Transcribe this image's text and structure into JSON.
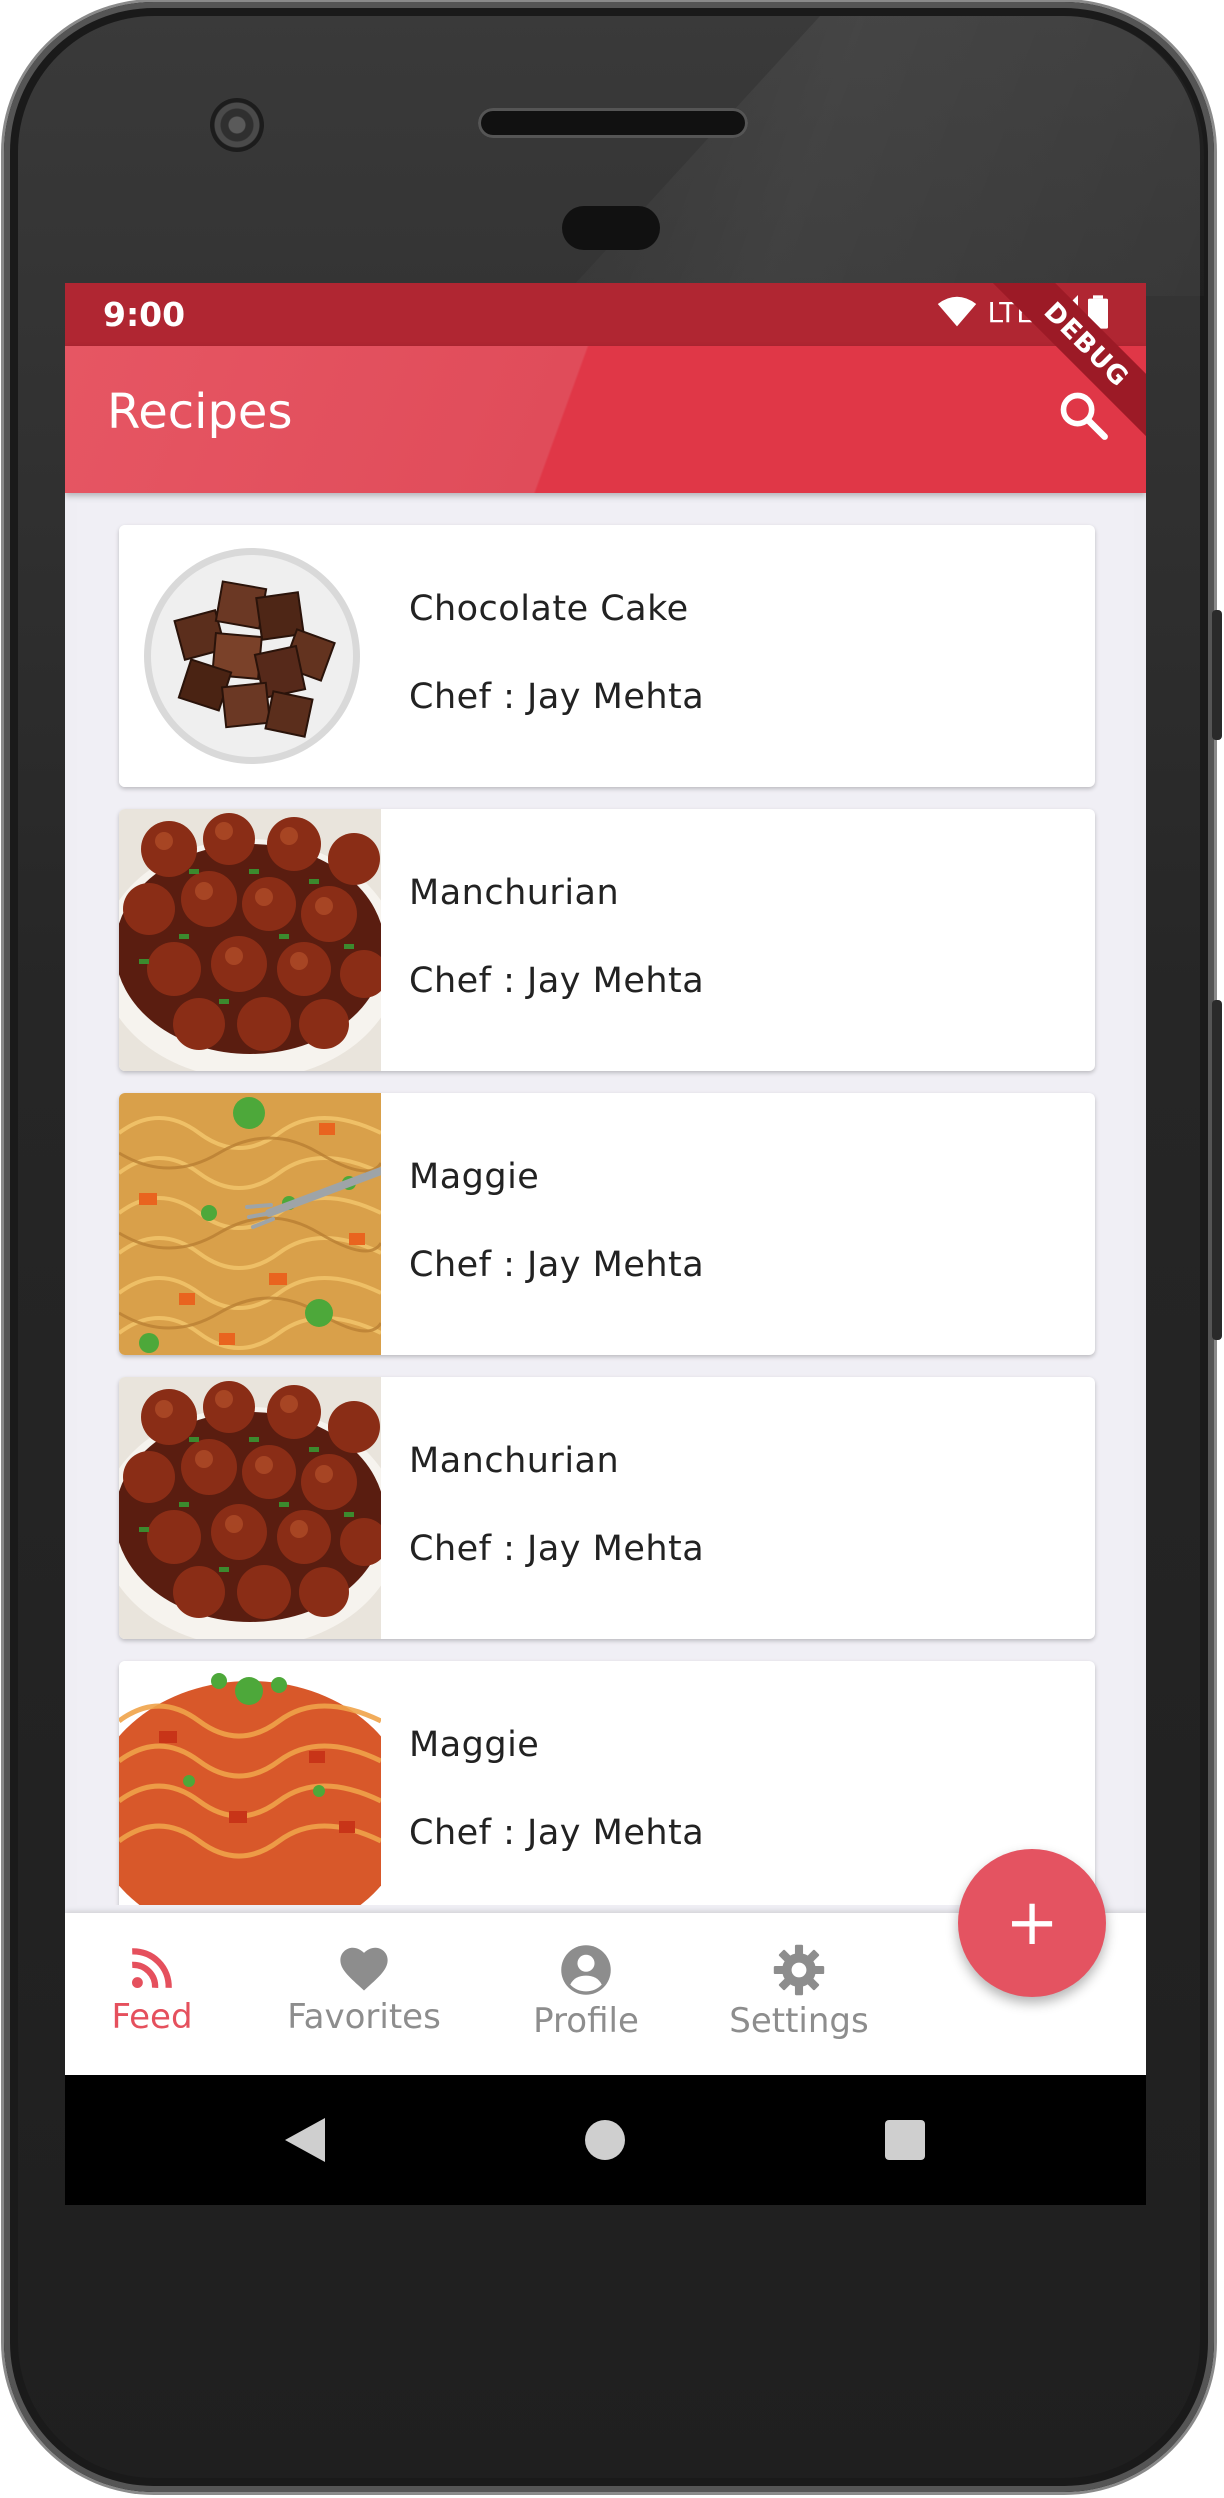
{
  "status_bar": {
    "time": "9:00",
    "network": "LTE"
  },
  "app_bar": {
    "title": "Recipes",
    "debug_banner": "DEBUG"
  },
  "recipes": [
    {
      "name": "Chocolate Cake",
      "chef": "Chef : Jay Mehta",
      "image": "chocolate-cake-image"
    },
    {
      "name": "Manchurian",
      "chef": "Chef : Jay Mehta",
      "image": "manchurian-image"
    },
    {
      "name": "Maggie",
      "chef": "Chef : Jay Mehta",
      "image": "maggie-image"
    },
    {
      "name": "Manchurian",
      "chef": "Chef : Jay Mehta",
      "image": "manchurian-image"
    },
    {
      "name": "Maggie",
      "chef": "Chef : Jay Mehta",
      "image": "maggie-image"
    }
  ],
  "fab": {
    "glyph": "+",
    "icon": "add-icon"
  },
  "bottom_nav": [
    {
      "label": "Feed",
      "icon": "rss-feed-icon",
      "active": true
    },
    {
      "label": "Favorites",
      "icon": "heart-icon",
      "active": false
    },
    {
      "label": "Profile",
      "icon": "account-circle-icon",
      "active": false
    },
    {
      "label": "Settings",
      "icon": "gear-icon",
      "active": false
    }
  ],
  "colors": {
    "primary": "#e04c5a",
    "status_bar": "#b02632",
    "fab": "#e45361",
    "inactive": "#8d8d8d",
    "background": "#f0eff5"
  }
}
